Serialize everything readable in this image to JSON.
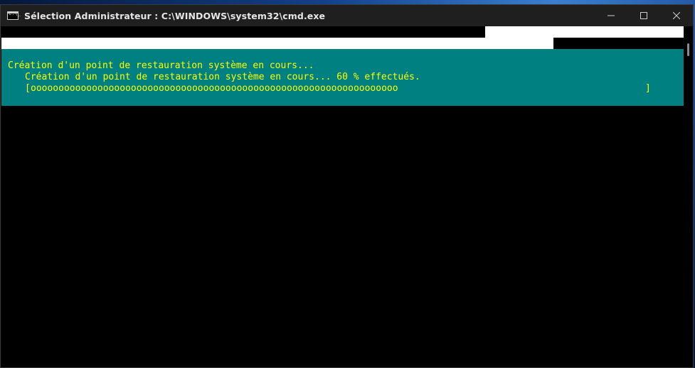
{
  "window": {
    "title": "Sélection Administrateur : C:\\WINDOWS\\system32\\cmd.exe",
    "icon": "cmd-icon",
    "controls": {
      "minimize": "minimize-icon",
      "maximize": "maximize-icon",
      "close": "close-icon"
    }
  },
  "console": {
    "line1": "Création d'un point de restauration système en cours...",
    "line2": "Création d'un point de restauration système en cours... 60 % effectués.",
    "progress": {
      "bracket_open": "[",
      "bar": "oooooooooooooooooooooooooooooooooooooooooooooooooooooooooooooooooo",
      "bracket_close": "]",
      "fraction": 0.6
    },
    "colors": {
      "background": "#000000",
      "highlight_background": "#008080",
      "text": "#ffff00"
    }
  }
}
